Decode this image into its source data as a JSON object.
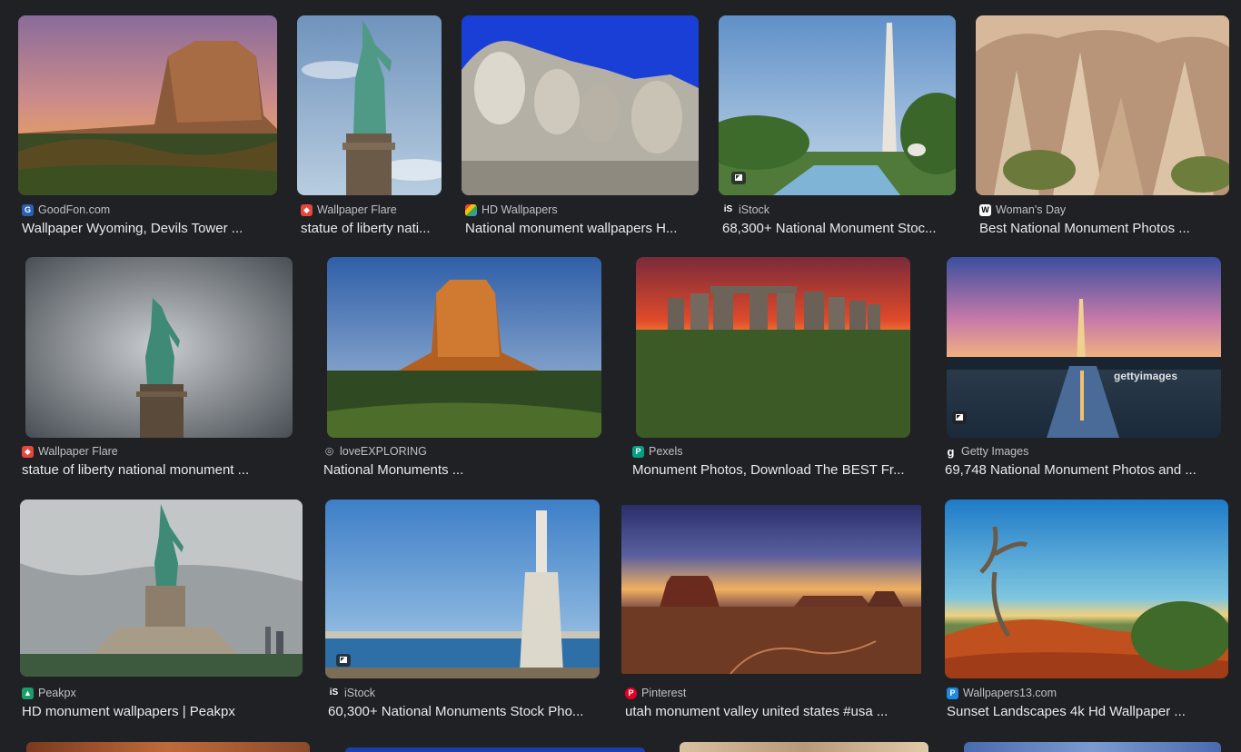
{
  "results": [
    {
      "source": "GoodFon.com",
      "title": "Wallpaper Wyoming, Devils Tower ...",
      "icon": "goodfon-icon",
      "color": "#2b5fb3",
      "glyph": "G"
    },
    {
      "source": "Wallpaper Flare",
      "title": "statue of liberty nati...",
      "icon": "wallpaper-flare-icon",
      "color": "#e8453c",
      "glyph": "◆"
    },
    {
      "source": "HD Wallpapers",
      "title": "National monument wallpapers H...",
      "icon": "hd-wallpapers-icon",
      "color": "#34a853",
      "glyph": "■"
    },
    {
      "source": "iStock",
      "title": "68,300+ National Monument Stoc...",
      "icon": "istock-icon",
      "color": "#202124",
      "glyph": "iS"
    },
    {
      "source": "Woman's Day",
      "title": "Best National Monument Photos ...",
      "icon": "womans-day-icon",
      "color": "#ffffff",
      "glyph": "W"
    },
    {
      "source": "Wallpaper Flare",
      "title": "statue of liberty national monument ...",
      "icon": "wallpaper-flare-icon",
      "color": "#e8453c",
      "glyph": "◆"
    },
    {
      "source": "loveEXPLORING",
      "title": "National Monuments ...",
      "icon": "globe-icon",
      "color": "#5f6368",
      "glyph": "◎"
    },
    {
      "source": "Pexels",
      "title": "Monument Photos, Download The BEST Fr...",
      "icon": "pexels-icon",
      "color": "#05a081",
      "glyph": "P"
    },
    {
      "source": "Getty Images",
      "title": "69,748 National Monument Photos and ...",
      "icon": "getty-images-icon",
      "color": "#202124",
      "glyph": "g"
    },
    {
      "source": "Peakpx",
      "title": "HD monument wallpapers | Peakpx",
      "icon": "peakpx-icon",
      "color": "#1a9e6b",
      "glyph": "▲"
    },
    {
      "source": "iStock",
      "title": "60,300+ National Monuments Stock Pho...",
      "icon": "istock-icon",
      "color": "#202124",
      "glyph": "iS"
    },
    {
      "source": "Pinterest",
      "title": "utah monument valley united states #usa ...",
      "icon": "pinterest-icon",
      "color": "#e60023",
      "glyph": "P"
    },
    {
      "source": "Wallpapers13.com",
      "title": "Sunset Landscapes 4k Hd Wallpaper ...",
      "icon": "wallpapers13-icon",
      "color": "#1e88e5",
      "glyph": "P"
    }
  ],
  "watermark": "gettyimages"
}
